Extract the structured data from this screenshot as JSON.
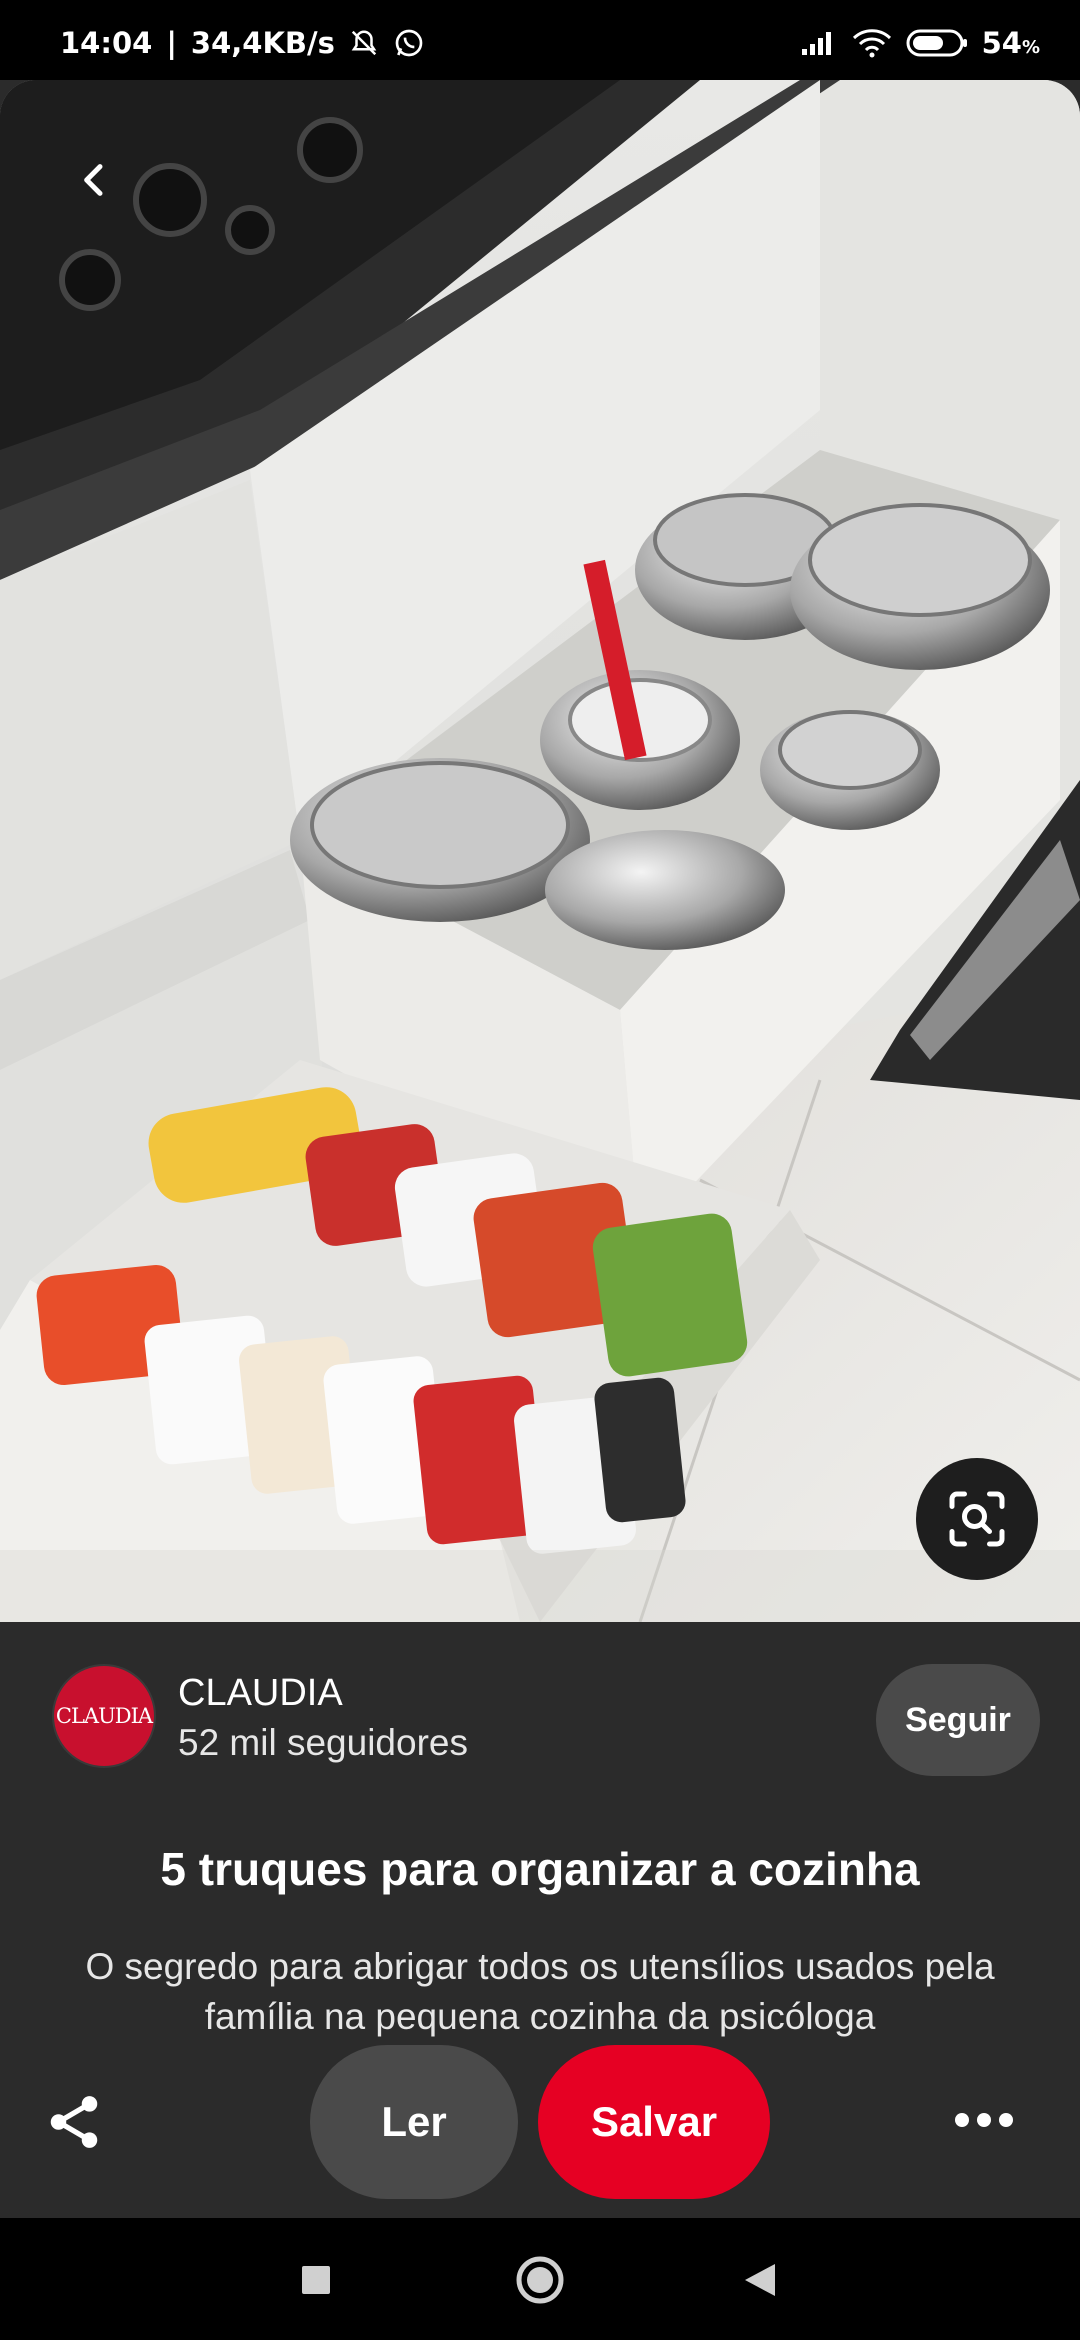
{
  "status_bar": {
    "time": "14:04",
    "speed": "34,4KB/s",
    "battery": "54",
    "battery_unit": "%",
    "icons": [
      "bell-off-icon",
      "whatsapp-icon",
      "signal-icon",
      "wifi-icon",
      "battery-icon"
    ]
  },
  "pin": {
    "image_description_icon": "kitchen-drawer-photo",
    "back_icon": "chevron-left-icon",
    "lens_icon": "visual-search-icon"
  },
  "creator": {
    "avatar_text": "CLAUDIA",
    "name": "CLAUDIA",
    "followers": "52 mil seguidores",
    "follow_label": "Seguir"
  },
  "content": {
    "title": "5 truques para organizar a cozinha",
    "description": "O segredo para abrigar todos os utensílios usados pela família na pequena cozinha da psicóloga"
  },
  "actions": {
    "share_icon": "share-icon",
    "read_label": "Ler",
    "save_label": "Salvar",
    "more_icon": "more-dots-icon"
  },
  "colors": {
    "panel_bg": "#2b2b2b",
    "save_red": "#e60023",
    "pill_gray": "#4a4a4a",
    "avatar_red": "#c8102e"
  }
}
